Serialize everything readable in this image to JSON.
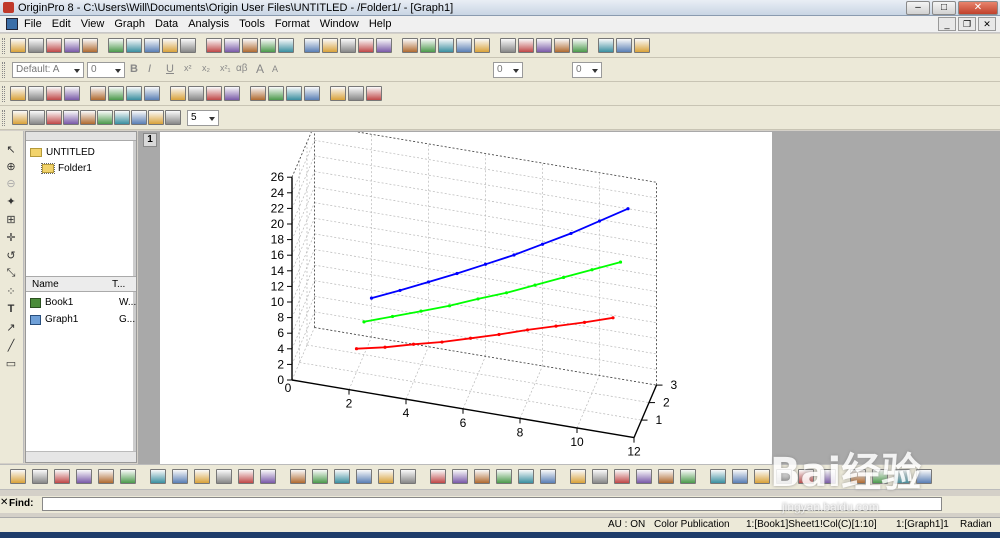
{
  "window": {
    "title": "OriginPro 8 - C:\\Users\\Will\\Documents\\Origin User Files\\UNTITLED - /Folder1/ - [Graph1]",
    "minimize": "–",
    "maximize": "□",
    "close": "✕"
  },
  "menu": [
    "File",
    "Edit",
    "View",
    "Graph",
    "Data",
    "Analysis",
    "Tools",
    "Format",
    "Window",
    "Help"
  ],
  "format_toolbar": {
    "font": "Default: A",
    "font_size": "0",
    "bold": "B",
    "italic": "I",
    "underline": "U",
    "superscript": "x²",
    "subscript": "x₂",
    "supsub": "x²₁",
    "greek": "αβ",
    "larger": "A",
    "smaller": "A",
    "line_width": "0",
    "fill_pattern": "0"
  },
  "plot_toolbar": {
    "count": "5"
  },
  "explorer": {
    "tree": [
      {
        "label": "UNTITLED"
      },
      {
        "label": "Folder1"
      }
    ],
    "columns": {
      "name": "Name",
      "type": "T..."
    },
    "items": [
      {
        "name": "Book1",
        "type": "W...",
        "icon": "workbook-icon"
      },
      {
        "name": "Graph1",
        "type": "G...",
        "icon": "graph-icon"
      }
    ]
  },
  "graph": {
    "page_number": "1"
  },
  "find": {
    "label": "Find:",
    "value": ""
  },
  "status": {
    "au": "AU : ON",
    "theme": "Color Publication",
    "cell": "1:[Book1]Sheet1!Col(C)[1:10]",
    "layer": "1:[Graph1]1",
    "angle": "Radian"
  },
  "watermark": {
    "brand": "Bai经验",
    "url": "jingyan.baidu.com"
  },
  "colors": {
    "series_red": "#ff0000",
    "series_green": "#00ff00",
    "series_blue": "#0000ff",
    "mdi_bg": "#a9a9a9"
  },
  "chart_data": {
    "type": "line",
    "projection": "3d",
    "x": [
      2,
      3,
      4,
      5,
      6,
      7,
      8,
      9,
      10,
      11
    ],
    "x_ticks": [
      2,
      4,
      6,
      8,
      10,
      12
    ],
    "xlim": [
      0,
      12
    ],
    "y_ticks": [
      1,
      2,
      3
    ],
    "ylim": [
      0,
      3
    ],
    "z_ticks": [
      0,
      2,
      4,
      6,
      8,
      10,
      12,
      14,
      16,
      18,
      20,
      22,
      24,
      26
    ],
    "zlim": [
      0,
      26
    ],
    "grid": true,
    "series": [
      {
        "y": 1,
        "color": "#ff0000",
        "values": [
          3.0,
          3.8,
          4.8,
          5.7,
          6.8,
          7.9,
          9.1,
          10.2,
          11.3,
          12.5
        ]
      },
      {
        "y": 2,
        "color": "#00ff00",
        "values": [
          4.2,
          5.5,
          6.8,
          8.1,
          9.6,
          11.0,
          12.6,
          14.2,
          15.8,
          17.4
        ]
      },
      {
        "y": 3,
        "color": "#0000ff",
        "values": [
          5.0,
          6.6,
          8.3,
          10.0,
          11.8,
          13.6,
          15.6,
          17.6,
          19.8,
          22.0
        ]
      }
    ]
  }
}
